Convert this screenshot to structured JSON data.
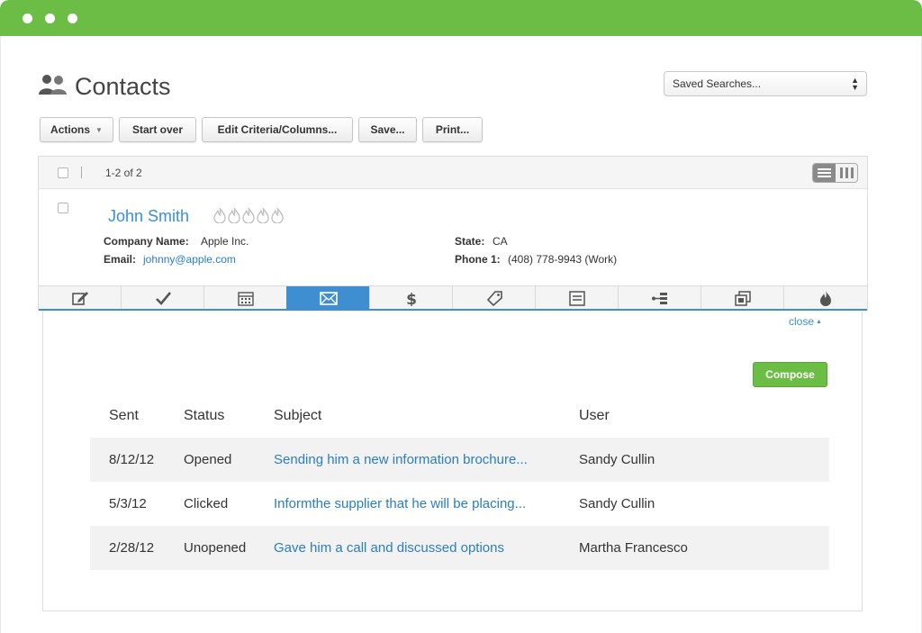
{
  "page": {
    "title": "Contacts",
    "saved_searches": "Saved Searches...",
    "icon": "contacts-people-icon"
  },
  "toolbar": {
    "actions_label": "Actions",
    "start_over_label": "Start over",
    "edit_criteria_label": "Edit Criteria/Columns...",
    "save_label": "Save...",
    "print_label": "Print..."
  },
  "results": {
    "count": "1-2 of 2"
  },
  "contact": {
    "name": "John Smith",
    "score_flames": 5,
    "company_label": "Company Name:",
    "company_value": "Apple Inc.",
    "email_label": "Email:",
    "email_value": "johnny@apple.com",
    "state_label": "State:",
    "state_value": "CA",
    "phone_label": "Phone 1:",
    "phone_value": "(408) 778-9943 (Work)"
  },
  "tabs": [
    {
      "icon": "edit-note-icon"
    },
    {
      "icon": "checkmark-icon"
    },
    {
      "icon": "calendar-icon"
    },
    {
      "icon": "envelope-icon",
      "active": true
    },
    {
      "icon": "dollar-icon"
    },
    {
      "icon": "tag-icon"
    },
    {
      "icon": "document-icon"
    },
    {
      "icon": "hierarchy-icon"
    },
    {
      "icon": "copy-icon"
    },
    {
      "icon": "flame-icon"
    }
  ],
  "email_panel": {
    "close_label": "close",
    "compose_label": "Compose",
    "columns": [
      "Sent",
      "Status",
      "Subject",
      "User"
    ],
    "rows": [
      {
        "sent": "8/12/12",
        "status": "Opened",
        "subject": "Sending him a new information brochure...",
        "user": "Sandy Cullin"
      },
      {
        "sent": "5/3/12",
        "status": "Clicked",
        "subject": "Informthe supplier that he will be placing...",
        "user": "Sandy Cullin"
      },
      {
        "sent": "2/28/12",
        "status": "Unopened",
        "subject": "Gave him a call and discussed options",
        "user": "Martha Francesco"
      }
    ]
  },
  "colors": {
    "brand_green": "#6cbd45",
    "accent_blue": "#3f8ed1",
    "link_blue": "#2a7ec0"
  }
}
